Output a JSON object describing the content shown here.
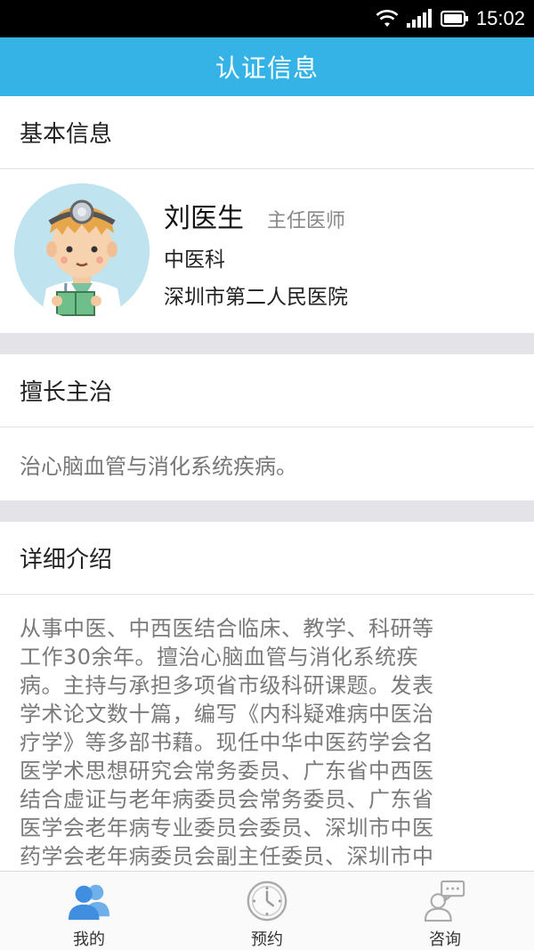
{
  "status": {
    "time": "15:02",
    "icons": [
      "wifi-icon",
      "signal-icon",
      "battery-icon"
    ]
  },
  "header": {
    "title": "认证信息"
  },
  "basic_info": {
    "section_title": "基本信息",
    "avatar": "doctor-avatar",
    "name": "刘医生",
    "title": "主任医师",
    "department": "中医科",
    "hospital": "深圳市第二人民医院"
  },
  "specialty": {
    "section_title": "擅长主治",
    "text": "治心脑血管与消化系统疾病。"
  },
  "detail": {
    "section_title": "详细介绍",
    "lines": [
      "从事中医、中西医结合临床、教学、科研等",
      "工作30余年。擅治心脑血管与消化系统疾",
      "病。主持与承担多项省市级科研课题。发表",
      "学术论文数十篇，编写《内科疑难病中医治",
      "疗学》等多部书藉。现任中华中医药学会名",
      "医学术思想研究会常务委员、广东省中西医",
      "结合虚证与老年病委员会常务委员、广东省",
      "医学会老年病专业委员会委员、深圳市中医",
      "药学会老年病委员会副主任委员、深圳市中"
    ]
  },
  "tabs": [
    {
      "label": "我的",
      "icon": "users-icon",
      "active": true
    },
    {
      "label": "预约",
      "icon": "clock-icon",
      "active": false
    },
    {
      "label": "咨询",
      "icon": "consult-icon",
      "active": false
    }
  ],
  "colors": {
    "header_bg": "#35b3e6",
    "active_icon": "#3f8ee0",
    "inactive_icon": "#aaaaaa",
    "divider_gap": "#e4e4e8"
  }
}
